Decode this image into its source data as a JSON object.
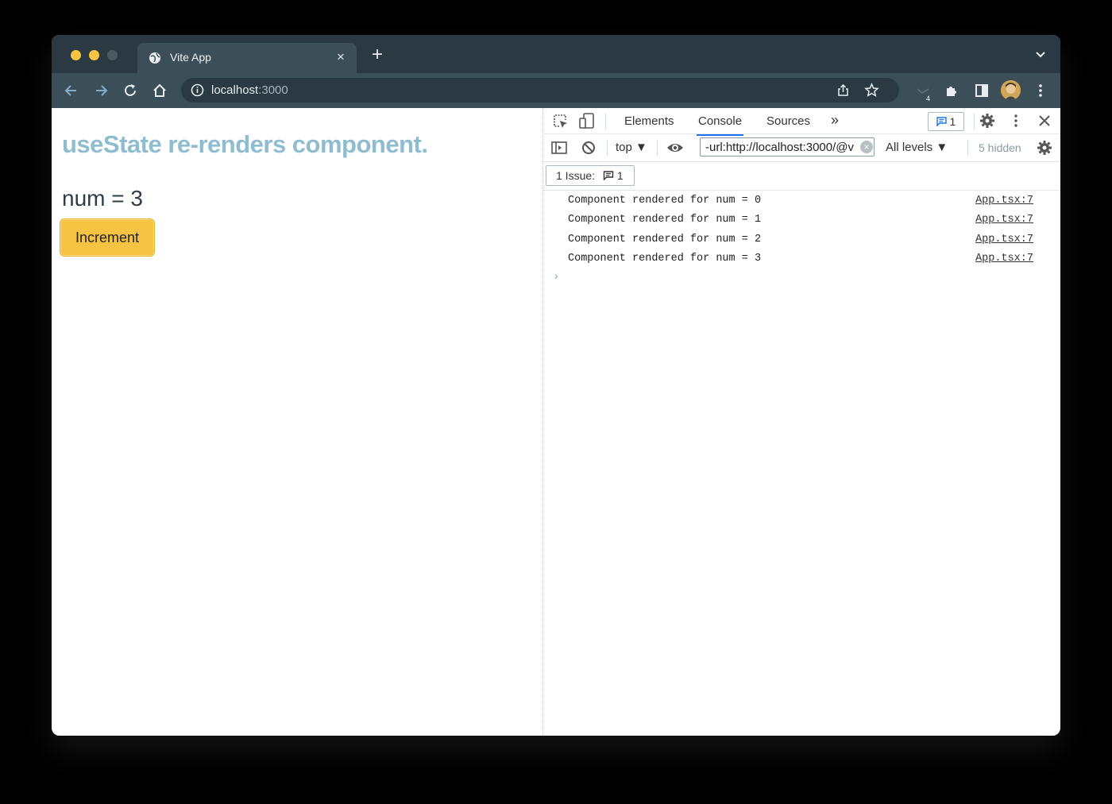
{
  "browser": {
    "tab_title": "Vite App",
    "tab_close": "×",
    "new_tab": "+",
    "url_host": "localhost",
    "url_port": ":3000",
    "extensions_badge": "4"
  },
  "page": {
    "heading": "useState re-renders component.",
    "num_text": "num = 3",
    "increment_label": "Increment"
  },
  "devtools": {
    "tabs": [
      "Elements",
      "Console",
      "Sources"
    ],
    "active_tab": "Console",
    "more_tabs": "»",
    "issue_count": "1",
    "context": "top ▼",
    "filter_value": "-url:http://localhost:3000/@v",
    "filter_clear": "×",
    "levels": "All levels ▼",
    "hidden": "5 hidden",
    "issues_label": "1 Issue:",
    "issues_count": "1",
    "prompt": "›",
    "logs": [
      {
        "message": "Component rendered for num = 0",
        "source": "App.tsx:7"
      },
      {
        "message": "Component rendered for num = 1",
        "source": "App.tsx:7"
      },
      {
        "message": "Component rendered for num = 2",
        "source": "App.tsx:7"
      },
      {
        "message": "Component rendered for num = 3",
        "source": "App.tsx:7"
      }
    ]
  },
  "colors": {
    "chrome_dark": "#2b3a42",
    "chrome_toolbar": "#3c4e57",
    "heading": "#8ebdd0",
    "button": "#f6c343",
    "accent_blue": "#1a73e8"
  },
  "icons": [
    "globe-icon",
    "back-icon",
    "forward-icon",
    "reload-icon",
    "home-icon",
    "info-icon",
    "share-icon",
    "star-icon",
    "extension-icon",
    "puzzle-icon",
    "side-panel-icon",
    "menu-icon",
    "inspect-icon",
    "device-icon",
    "gear-icon",
    "kebab-icon",
    "close-icon",
    "sidebar-toggle-icon",
    "block-icon",
    "eye-icon",
    "message-icon"
  ]
}
